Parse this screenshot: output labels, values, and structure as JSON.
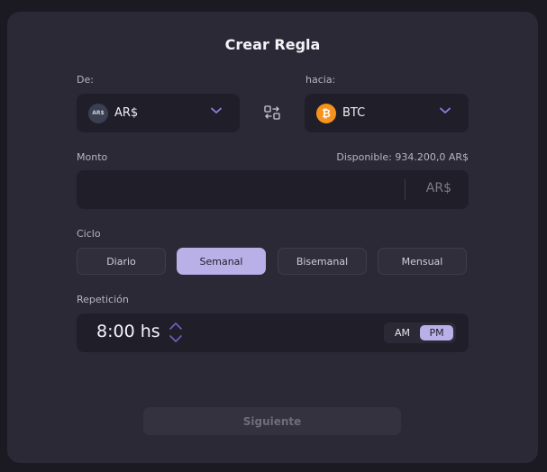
{
  "title": "Crear Regla",
  "from": {
    "label": "De:",
    "currency": "AR$",
    "coin_text": "AR$"
  },
  "to": {
    "label": "hacia:",
    "currency": "BTC",
    "coin_text": "₿"
  },
  "amount": {
    "label": "Monto",
    "available": "Disponible: 934.200,0 AR$",
    "value": "",
    "unit": "AR$"
  },
  "cycle": {
    "label": "Ciclo",
    "options": [
      "Diario",
      "Semanal",
      "Bisemanal",
      "Mensual"
    ],
    "selected": "Semanal"
  },
  "repetition": {
    "label": "Repetición",
    "time": "8:00 hs",
    "am": "AM",
    "pm": "PM",
    "selected_period": "PM"
  },
  "next_button": "Siguiente",
  "colors": {
    "accent": "#b9b0e8",
    "btc": "#f7931a",
    "card": "#2a2935",
    "field": "#201f29"
  }
}
